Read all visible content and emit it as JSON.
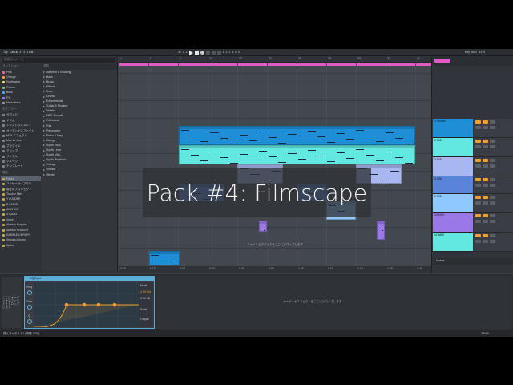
{
  "transport": {
    "tap": "Tap",
    "tempo": "105.00",
    "signature": "4 / 4",
    "quantize": "1 Bar",
    "position": "37. 1. 1",
    "loop_start": "1. 1. 1",
    "loop_len": "4. 0. 0",
    "key": "Key",
    "midi": "MIDI",
    "cpu": "14 %"
  },
  "browser": {
    "search_placeholder": "検索 (Cmd + F)",
    "collections_header": "コレクション",
    "collections": [
      {
        "label": "Pink",
        "color": "#ff5b9a"
      },
      {
        "label": "Orange",
        "color": "#ff9a2e"
      },
      {
        "label": "Synthwave",
        "color": "#ffe04a"
      },
      {
        "label": "Pianos",
        "color": "#5fd16a"
      },
      {
        "label": "Bass",
        "color": "#44a6ff"
      },
      {
        "label": "FX",
        "color": "#9a7cff"
      },
      {
        "label": "Modulators",
        "color": "#9da2a8"
      }
    ],
    "categories_header": "カテゴリー",
    "categories": [
      "サウンド",
      "ドラム",
      "インストゥルメント",
      "オーディオエフェクト",
      "MIDI エフェクト",
      "Max for Live",
      "プラグイン",
      "クリップ",
      "サンプル",
      "グルーヴ",
      "テンプレート"
    ],
    "places_header": "場所",
    "places": [
      "Packs",
      "ユーザーライブラリ",
      "現在のプロジェクト",
      "Tracker Files",
      "Y FOLDER",
      "B.F.NEW",
      "ARCHIVE",
      "STUDIO",
      "Voice",
      "Ableton Projects",
      "Ableton Producer",
      "SAMPLE LIBRARY",
      "Session Drums",
      "Splice"
    ],
    "list_header": "名前",
    "folders": [
      "Ambient & Evolving",
      "Bass",
      "Brass",
      "Effects",
      "Keys",
      "Drums",
      "Experimental",
      "Guitar & Plucked",
      "Mallets",
      "MPE Sounds",
      "Orchestral",
      "Pad",
      "Percussive",
      "Piano & Keys",
      "Strings",
      "Synth Keys",
      "Synth Lead",
      "Synth Misc",
      "Synth Rhythmic",
      "Vintage",
      "Voices",
      "Winds"
    ]
  },
  "arrangement": {
    "bar_numbers": [
      "1",
      "5",
      "9",
      "13",
      "17",
      "21",
      "25",
      "29",
      "33",
      "37",
      "41"
    ],
    "time_marks": [
      "0:00",
      "0:10",
      "0:20",
      "0:30",
      "0:40",
      "0:50",
      "1:00",
      "1:10",
      "1:20",
      "1:30",
      "1:40"
    ],
    "drop_text": "ファイルとデバイスをここにドロップします",
    "loop_color": "#e05ac8"
  },
  "mixer": {
    "master_label": "Master",
    "tracks": [
      {
        "label": "1 Stream",
        "color": "#1e8fd6"
      },
      {
        "label": "2 MIDI",
        "color": "#62e8e0"
      },
      {
        "label": "3 MIDI",
        "color": "#a9b7f0"
      },
      {
        "label": "4 MIDI",
        "color": "#5a84d8"
      },
      {
        "label": "5 MIDI",
        "color": "#8ec8ff"
      },
      {
        "label": "10 MIDI",
        "color": "#9a79e6"
      },
      {
        "label": "11 MIDI",
        "color": "#62e8e0"
      },
      {
        "label": "Main",
        "color": "#1e8fd6"
      }
    ]
  },
  "device": {
    "macro_text": "ここにオーディオエフェクトをドロップします",
    "eq_title": "EQ Eight",
    "drop_text": "オーディオエフェクトをここにドロップします",
    "freq_label": "Freq",
    "gain_label": "Gain",
    "q_label": "Q",
    "mode_label": "Mode",
    "scale_label": "Scale",
    "output_label": "Output",
    "freq_value": "2.00 kHz",
    "gain_value": "0.00 dB"
  },
  "status": {
    "left_text": "挿入マーク 1.1.1 (時間: 0:00)",
    "right_text": "2 MIDI"
  },
  "overlay": {
    "title": "Pack #4: Filmscape"
  }
}
